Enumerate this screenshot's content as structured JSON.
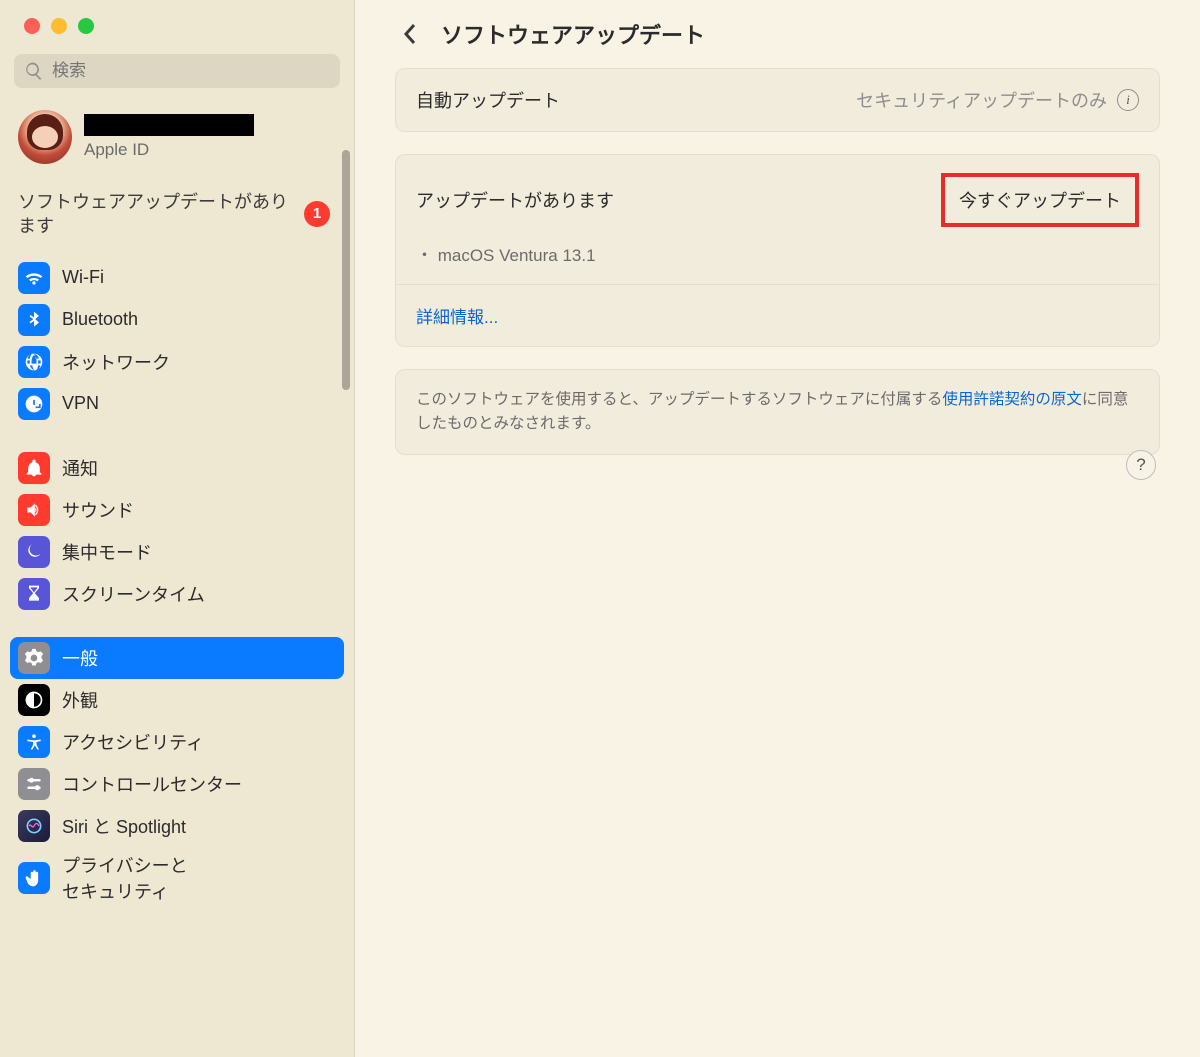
{
  "search": {
    "placeholder": "検索"
  },
  "account": {
    "sub": "Apple ID"
  },
  "updateNotice": {
    "text": "ソフトウェアアップデートがあります",
    "count": "1"
  },
  "sidebar": {
    "g1": [
      {
        "label": "Wi-Fi"
      },
      {
        "label": "Bluetooth"
      },
      {
        "label": "ネットワーク"
      },
      {
        "label": "VPN"
      }
    ],
    "g2": [
      {
        "label": "通知"
      },
      {
        "label": "サウンド"
      },
      {
        "label": "集中モード"
      },
      {
        "label": "スクリーンタイム"
      }
    ],
    "g3": [
      {
        "label": "一般"
      },
      {
        "label": "外観"
      },
      {
        "label": "アクセシビリティ"
      },
      {
        "label": "コントロールセンター"
      },
      {
        "label": "Siri と Spotlight"
      },
      {
        "label": "プライバシーと\nセキュリティ"
      }
    ]
  },
  "main": {
    "title": "ソフトウェアアップデート",
    "auto": {
      "label": "自動アップデート",
      "value": "セキュリティアップデートのみ"
    },
    "update": {
      "heading": "アップデートがあります",
      "button": "今すぐアップデート",
      "item": "・ macOS Ventura 13.1",
      "moreInfo": "詳細情報..."
    },
    "agreement": {
      "prefix": "このソフトウェアを使用すると、アップデートするソフトウェアに付属する",
      "link": "使用許諾契約の原文",
      "suffix": "に同意したものとみなされます。"
    },
    "help": "?"
  }
}
